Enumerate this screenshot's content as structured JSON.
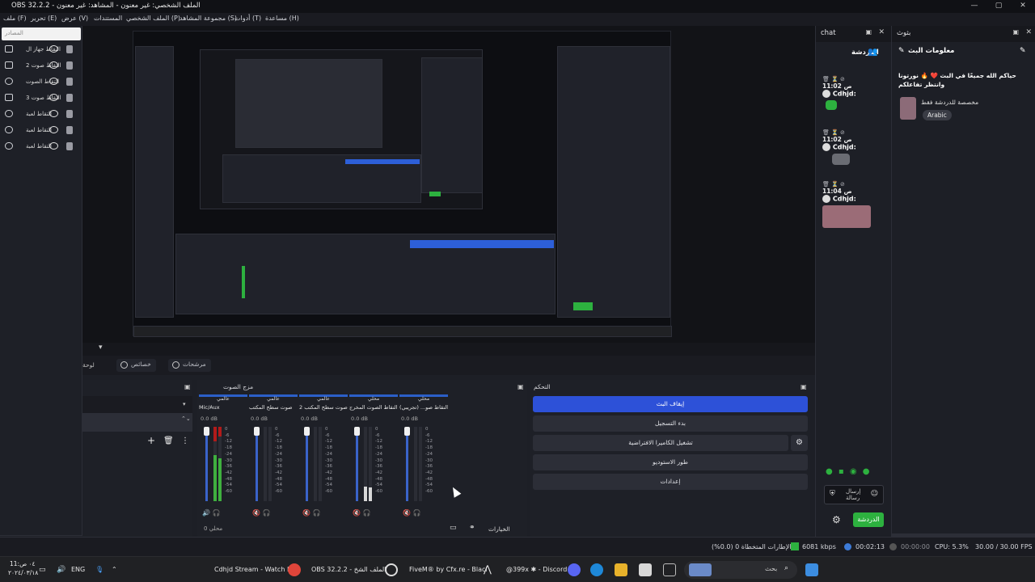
{
  "window": {
    "title": "OBS 32.2.2 - الملف الشخصي: غير معنون - المشاهد: غير معنون",
    "controls": [
      "—",
      "▢",
      "✕"
    ]
  },
  "menu": [
    "ملف (F)",
    "تحرير (E)",
    "عرض (V)",
    "المستندات",
    "الملف الشخصي (P)",
    "مجموعة المشاهد (S)",
    "أدوات (T)",
    "مساعدة (H)"
  ],
  "sources": {
    "filter_placeholder": "المصادر",
    "items": [
      {
        "label": "التقاط جهاز ال",
        "icon": "monitor-icon"
      },
      {
        "label": "التقاط صوت 2",
        "icon": "monitor-icon"
      },
      {
        "label": "التقاط الصوت",
        "icon": "speaker-icon"
      },
      {
        "label": "التقاط صوت 3",
        "icon": "monitor-icon"
      },
      {
        "label": "التقاط لعبة",
        "icon": "gamepad-icon"
      },
      {
        "label": "التقاط لعبة",
        "icon": "gamepad-icon"
      },
      {
        "label": "التقاط لعبة",
        "icon": "gamepad-icon"
      }
    ],
    "toolbar": [
      "+",
      "🗑",
      "⚙",
      "⌃"
    ]
  },
  "tabs": {
    "filters": "مرشحات",
    "properties": "خصائص",
    "transitions": "لوحة"
  },
  "mixer": {
    "title": "مزج الصوت",
    "channels": [
      {
        "tag": "عالمي",
        "name": "Mic/Aux",
        "db": "0.0 dB",
        "level": 0.62
      },
      {
        "tag": "عالمي",
        "name": "صوت سطح المكتب",
        "db": "0.0 dB",
        "level": 0.0
      },
      {
        "tag": "عالمي",
        "name": "صوت سطح المكتب 2",
        "db": "0.0 dB",
        "level": 0.0
      },
      {
        "tag": "محلي",
        "name": "التقاط الصوت المخرج",
        "db": "0.0 dB",
        "level": 0.2
      },
      {
        "tag": "محلي",
        "name": "التقاط صو... (تجريبي)",
        "db": "0.0 dB",
        "level": 0.0
      }
    ],
    "scale": [
      "0",
      "-6",
      "-12",
      "-18",
      "-24",
      "-30",
      "-36",
      "-42",
      "-48",
      "-54",
      "-60"
    ],
    "foot_left": "محلي 0",
    "foot_options": "الخيارات"
  },
  "controls": {
    "title": "التحكم",
    "stop_stream": "إيقاف البث",
    "start_recording": "بدء التسجيل",
    "virtual_camera": "تشغيل الكاميرا الافتراضية",
    "studio_mode": "طور الاستوديو",
    "settings": "إعدادات"
  },
  "chat": {
    "title": "chat",
    "header_label": "الدردشة",
    "messages": [
      {
        "time": "11:02 ص",
        "user": "Cdhjd:"
      },
      {
        "time": "11:02 ص",
        "user": "Cdhjd:"
      },
      {
        "time": "11:04 ص",
        "user": "Cdhjd:"
      }
    ],
    "send_label": "إرسال رسالة",
    "chat_button": "الدردشة"
  },
  "stream_info": {
    "title": "بثوث",
    "section": "معلومات البث",
    "heading": "حياكم الله جميعًا في البث ❤️ 🔥 نورتونا وانتظر تفاعلكم",
    "subtitle": "مخصصة للدردشة فقط",
    "language_badge": "Arabic"
  },
  "status": {
    "dropped": "الإطارات المتخطاة 0 (0.0%)",
    "bitrate": "6081 kbps",
    "stream_time": "00:02:13",
    "rec_time": "00:00:00",
    "cpu": "CPU: 5.3%",
    "fps": "30.00 / 30.00 FPS"
  },
  "taskbar": {
    "clock_time": "11:٠٤ ص",
    "clock_date": "٢٠٢٤/٠٣/١٨",
    "language": "ENG",
    "apps": [
      "Cdhjd Stream - Watch L",
      "OBS 32.2.2 - الملف الشخ",
      "FiveM® by Cfx.re - Blacl",
      "@399x ✱ - Discord"
    ],
    "search_placeholder": "بحث"
  },
  "colors": {
    "accent_blue": "#2d51d8",
    "live_green": "#2db13f",
    "meter_red": "#b21a1a"
  }
}
